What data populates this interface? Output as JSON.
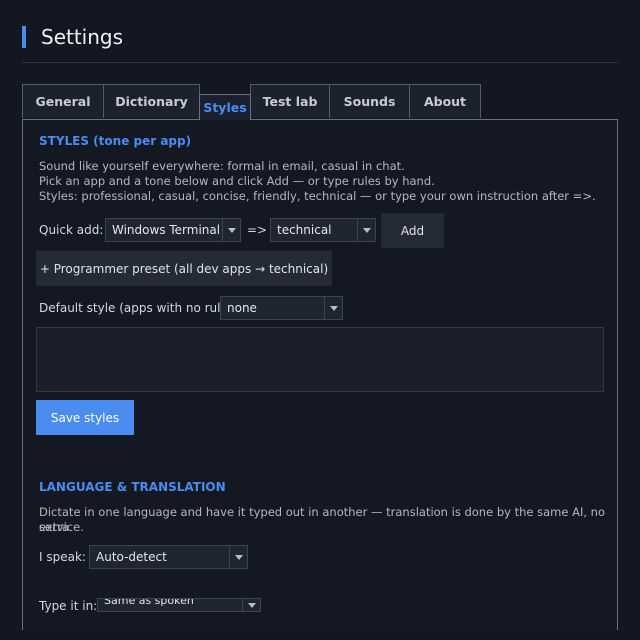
{
  "page": {
    "title": "Settings"
  },
  "tabs": [
    {
      "label": "General",
      "active": false
    },
    {
      "label": "Dictionary",
      "active": false
    },
    {
      "label": "Styles",
      "active": true
    },
    {
      "label": "Test lab",
      "active": false
    },
    {
      "label": "Sounds",
      "active": false
    },
    {
      "label": "About",
      "active": false
    }
  ],
  "styles": {
    "heading": "STYLES  (tone per app)",
    "desc_lines": [
      "Sound like yourself everywhere: formal in email, casual in chat.",
      "Pick an app and a tone below and click Add — or type rules by hand.",
      "Styles: professional, casual, concise, friendly, technical  — or type your own instruction after =>."
    ],
    "quick_add_label": "Quick add:",
    "app_value": "Windows Terminal",
    "arrow": "=>",
    "tone_value": "technical",
    "add_label": "Add",
    "preset_label": "+  Programmer preset (all dev apps → technical)",
    "default_label": "Default style (apps with no rule):",
    "default_value": "none",
    "rules_text": "",
    "save_label": "Save styles"
  },
  "language": {
    "heading": "LANGUAGE & TRANSLATION",
    "desc_lines": [
      "Dictate in one language and have it typed out in another — translation is done by the same AI, no extra",
      "service."
    ],
    "speak_label": "I speak:",
    "speak_value": "Auto-detect",
    "type_label": "Type it in:",
    "type_value": "Same as spoken"
  },
  "colors": {
    "accent": "#4a8cf0",
    "background": "#121722"
  }
}
